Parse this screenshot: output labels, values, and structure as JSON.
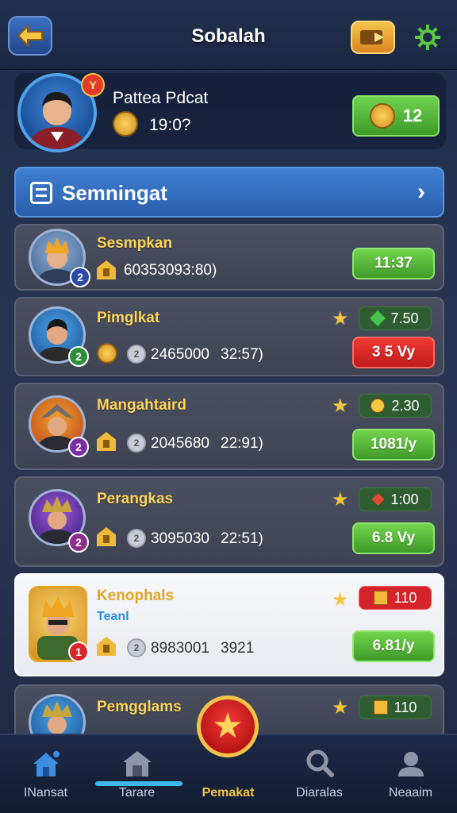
{
  "header": {
    "title": "Sobalah"
  },
  "profile": {
    "name": "Pattea Pdcat",
    "value": "19:0?",
    "green_value": "12"
  },
  "section": {
    "title": "Semningat"
  },
  "rows": [
    {
      "name": "Sesmpkan",
      "sub": "",
      "rank": "2",
      "stat_a": "60353093:80)",
      "stat_b": "",
      "pill": "",
      "button": "11:37",
      "button_color": "green"
    },
    {
      "name": "Pimglkat",
      "sub": "",
      "rank": "2",
      "stat_a": "2465000",
      "stat_b": "32:57)",
      "pill": "7.50",
      "button": "3 5 Vy",
      "button_color": "red"
    },
    {
      "name": "Mangahtaird",
      "sub": "",
      "rank": "2",
      "stat_a": "2045680",
      "stat_b": "22:91)",
      "pill": "2.30",
      "button": "1081/y",
      "button_color": "green"
    },
    {
      "name": "Perangkas",
      "sub": "",
      "rank": "2",
      "stat_a": "3095030",
      "stat_b": "22:51)",
      "pill": "1:00",
      "button": "6.8 Vy",
      "button_color": "green"
    },
    {
      "name": "Kenophals",
      "sub": "Teanl",
      "rank": "1",
      "stat_a": "8983001",
      "stat_b": "3921",
      "pill": "110",
      "button": "6.81/y",
      "button_color": "green"
    },
    {
      "name": "Pemgglams",
      "sub": "",
      "rank": "",
      "stat_a": "",
      "stat_b": "",
      "pill": "110",
      "button": "",
      "button_color": "green"
    }
  ],
  "nav": {
    "items": [
      {
        "label": "INansat",
        "icon": "home-icon",
        "active": false
      },
      {
        "label": "Tarare",
        "icon": "barn-icon",
        "active": false
      },
      {
        "label": "Pemakat",
        "icon": "star-badge-icon",
        "active": true
      },
      {
        "label": "Diaralas",
        "icon": "search-icon",
        "active": false
      },
      {
        "label": "Neaaim",
        "icon": "profile-icon",
        "active": false
      }
    ]
  },
  "colors": {
    "accent_gold": "#f6c544",
    "button_green": "#4eae33",
    "button_red": "#d2242a",
    "section_blue": "#3370c2"
  }
}
